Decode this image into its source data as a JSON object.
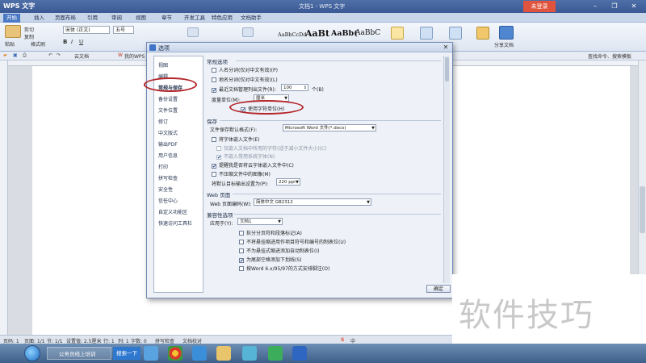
{
  "app": {
    "name": "WPS 文字",
    "doc_title": "文档1 - WPS 文字",
    "login": "未登录"
  },
  "ribbon_tabs": [
    "开始",
    "插入",
    "页面布局",
    "引用",
    "审阅",
    "视图",
    "章节",
    "开发工具",
    "特色应用",
    "文档助手"
  ],
  "ribbon": {
    "paste": "粘贴",
    "cut": "剪切",
    "copy": "复制",
    "format_painter": "格式刷",
    "font": "宋体 (正文)",
    "size": "五号",
    "styles": [
      "AaBbCcDd",
      "AaBt",
      "AaBb(",
      "AaBbC"
    ],
    "share": "分享文档"
  },
  "doc_tabs": {
    "cloud": "云文档",
    "my_wps": "我的WPS",
    "find": "查找命令、搜索模板"
  },
  "dialog": {
    "title": "选项",
    "nav": [
      "视图",
      "编辑",
      "常规与保存",
      "备份设置",
      "文件位置",
      "修订",
      "中文版式",
      "输出PDF",
      "用户信息",
      "打印",
      "拼写检查",
      "安全性",
      "信任中心",
      "自定义功能区",
      "快速访问工具栏"
    ],
    "general": {
      "header": "常规选项",
      "opt1": "人名分词(仅对中文有效)(P)",
      "opt2": "地名分词(仅对中文有效)(L)",
      "opt3": "最近文档管理列出文件(R):",
      "recent_count": "100",
      "recent_unit": "个(B)",
      "unit_label": "度量单位(M):",
      "unit_value": "厘米",
      "char_unit": "使用字符单位(H)"
    },
    "save": {
      "header": "保存",
      "format_label": "文件保存默认格式(F):",
      "format_value": "Microsoft Word 文件(*.docx)",
      "embed_fonts": "将字体嵌入文件(E)",
      "embed_used": "仅嵌入文档中所用的字符(适于减小文件大小)(C)",
      "no_common": "不嵌入常用系统字体(N)",
      "cloud_embed": "提醒我是否将云字体嵌入文件中(C)",
      "no_compress": "不压缩文件中的图像(M)",
      "dpi_label": "将默认目标输出设置为(P):",
      "dpi_value": "220 ppi"
    },
    "web": {
      "header": "Web 页面",
      "encoding_label": "Web 页面编码(W):",
      "encoding_value": "简体中文 GB2312"
    },
    "compat": {
      "header": "兼容性选项",
      "apply_label": "应用于(Y):",
      "apply_value": "文档1",
      "c1": "拆分分页符和段落标记(A)",
      "c2": "不将悬挂缩进用作项目符号和编号的制表位(U)",
      "c3": "不为悬挂式缩进添加自动制表位(I)",
      "c4": "为尾部空格添加下划线(S)",
      "c5": "按Word 6.x/95/97的方式安排脚注(O)"
    },
    "ok": "确定"
  },
  "status": {
    "page": "页码: 1",
    "pages": "页面: 1/1",
    "section": "节: 1/1",
    "setting": "设置值: 2.5厘米",
    "row": "行: 1",
    "col": "列: 1",
    "words": "字数: 0",
    "spell": "拼写检查",
    "proof": "文档校对"
  },
  "taskbar": {
    "ie_item": "公务员线上培训",
    "search": "搜索一下"
  },
  "watermark": "软件技巧"
}
